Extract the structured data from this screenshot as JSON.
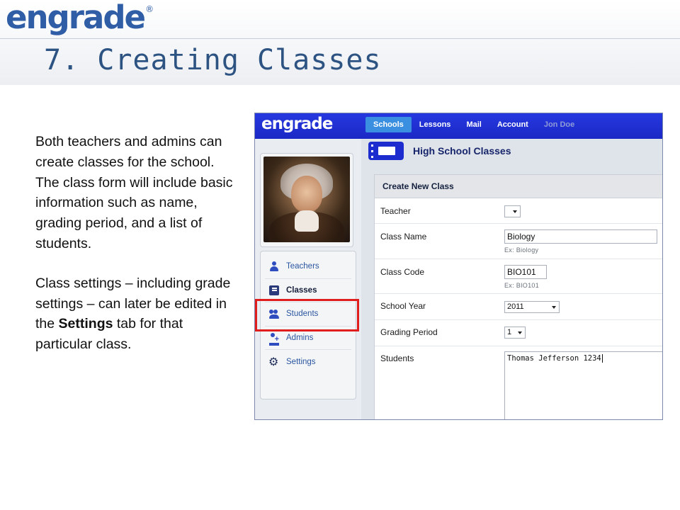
{
  "slide": {
    "logo_text": "engrade",
    "logo_mark": "®",
    "title": "7. Creating Classes",
    "paragraph_1": "Both teachers and admins can create classes for the school. The class form will include basic information such as name, grading period, and a list of students.",
    "paragraph_2_before": "Class settings – including grade settings – can later be edited in the ",
    "paragraph_2_bold": "Settings",
    "paragraph_2_after": " tab for that particular class."
  },
  "app": {
    "logo_text": "engrade",
    "nav": [
      {
        "label": "Schools",
        "active": true
      },
      {
        "label": "Lessons",
        "active": false
      },
      {
        "label": "Mail",
        "active": false
      },
      {
        "label": "Account",
        "active": false
      },
      {
        "label": "Jon Doe",
        "active": false
      }
    ],
    "sidebar": {
      "items": [
        {
          "label": "Teachers",
          "icon": "person-icon"
        },
        {
          "label": "Classes",
          "icon": "book-icon",
          "selected": true
        },
        {
          "label": "Students",
          "icon": "people-icon"
        },
        {
          "label": "Admins",
          "icon": "add-admin-icon"
        },
        {
          "label": "Settings",
          "icon": "gear-icon"
        }
      ]
    },
    "panel_title": "High School Classes",
    "form": {
      "heading": "Create New Class",
      "teacher_label": "Teacher",
      "teacher_value": "",
      "class_name_label": "Class Name",
      "class_name_value": "Biology",
      "class_name_hint": "Ex: Biology",
      "class_code_label": "Class Code",
      "class_code_value": "BIO101",
      "class_code_hint": "Ex: BIO101",
      "school_year_label": "School Year",
      "school_year_value": "2011",
      "grading_period_label": "Grading Period",
      "grading_period_value": "1",
      "students_label": "Students",
      "students_value": "Thomas Jefferson 1234"
    },
    "colors": {
      "topbar": "#1b2fd6",
      "nav_active": "#3a8fe0",
      "highlight": "#e01e1e",
      "title": "#2d5383"
    }
  }
}
